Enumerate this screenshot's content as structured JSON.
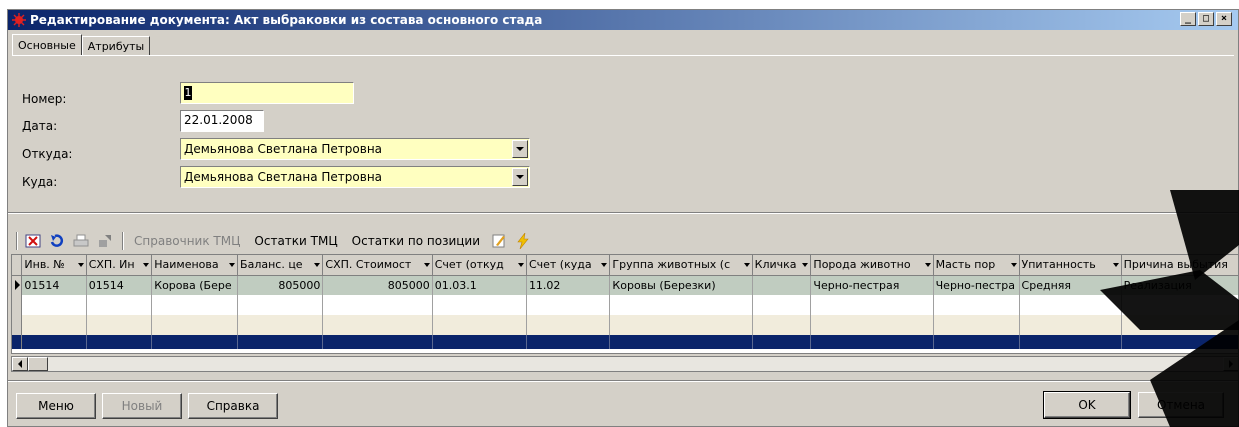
{
  "window": {
    "title": "Редактирование документа: Акт выбраковки из состава основного стада",
    "minimize_label": "_",
    "maximize_label": "□",
    "close_label": "×"
  },
  "tabs": [
    {
      "label": "Основные",
      "active": true
    },
    {
      "label": "Атрибуты",
      "active": false
    }
  ],
  "form": {
    "number_label": "Номер:",
    "number_value": "1",
    "date_label": "Дата:",
    "date_value": "22.01.2008",
    "from_label": "Откуда:",
    "from_value": "Демьянова  Светлана  Петровна",
    "to_label": "Куда:",
    "to_value": "Демьянова  Светлана  Петровна"
  },
  "toolbar": {
    "icons": [
      "delete-icon",
      "refresh-icon",
      "print-icon",
      "import-icon",
      "edit-icon",
      "lightning-icon"
    ],
    "catalog_label": "Справочник ТМЦ",
    "stock_label": "Остатки ТМЦ",
    "position_stock_label": "Остатки по позиции"
  },
  "grid": {
    "columns": [
      "Инв. №",
      "СХП. Ин",
      "Наименова",
      "Баланс. це",
      "СХП. Стоимост",
      "Счет (откуд",
      "Счет (куда",
      "Группа животных (с",
      "Кличка",
      "Порода животно",
      "Масть пор",
      "Упитанность",
      "Причина выбытия"
    ],
    "rows": [
      [
        "01514",
        "01514",
        "Корова (Бере",
        "805000",
        "805000",
        "01.03.1",
        "11.02",
        "Коровы (Березки)",
        "",
        "Черно-пестрая",
        "Черно-пестра",
        "Средняя",
        "Реализация"
      ]
    ]
  },
  "buttons": {
    "menu": "Меню",
    "new": "Новый",
    "help": "Справка",
    "ok": "OK",
    "cancel": "Отмена"
  },
  "colors": {
    "title_start": "#0a246a",
    "title_end": "#a6caf0",
    "field_yellow": "#ffffc0",
    "selected_row": "#0a246a",
    "window_bg": "#d4d0c8"
  }
}
